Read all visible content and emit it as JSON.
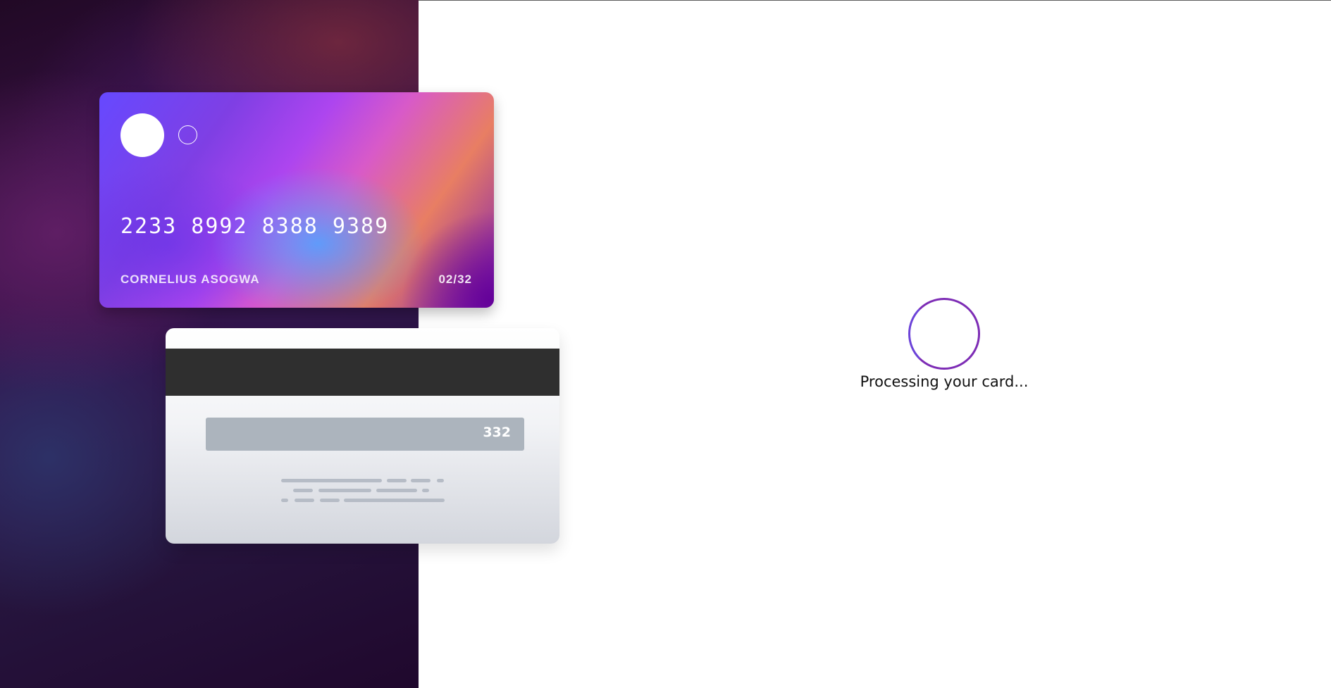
{
  "card_front": {
    "number": "2233 8992 8388 9389",
    "holder": "CORNELIUS ASOGWA",
    "expiry": "02/32"
  },
  "card_back": {
    "cvv": "332"
  },
  "status": {
    "message": "Processing your card..."
  },
  "colors": {
    "accent": "#7D2CB5",
    "card_gradient_start": "#6649FF",
    "card_gradient_end": "#7A1AB6",
    "background_panel": "#27103A",
    "loader": "#6C43D8"
  },
  "icons": {
    "card_chip_primary": "circle",
    "card_chip_secondary": "ring",
    "loading_indicator": "circle-spinner"
  }
}
